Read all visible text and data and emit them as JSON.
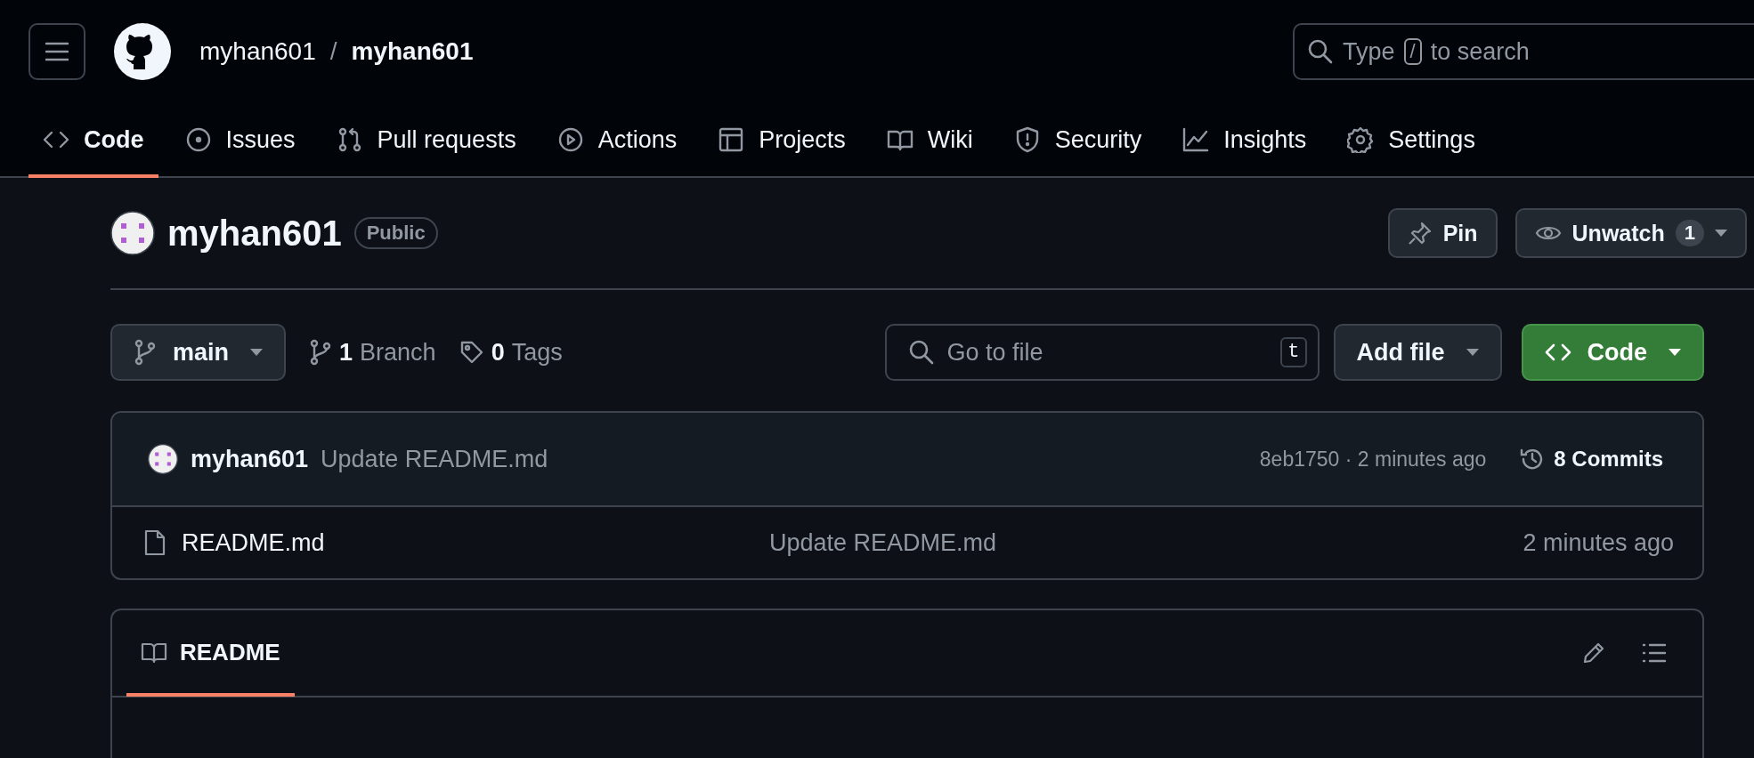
{
  "header": {
    "breadcrumb": [
      {
        "label": "myhan601"
      },
      {
        "label": "myhan601"
      }
    ],
    "separator": "/",
    "search": {
      "prefix": "Type",
      "key": "/",
      "suffix": "to search"
    }
  },
  "tabs": [
    {
      "label": "Code",
      "selected": true
    },
    {
      "label": "Issues",
      "selected": false
    },
    {
      "label": "Pull requests",
      "selected": false
    },
    {
      "label": "Actions",
      "selected": false
    },
    {
      "label": "Projects",
      "selected": false
    },
    {
      "label": "Wiki",
      "selected": false
    },
    {
      "label": "Security",
      "selected": false
    },
    {
      "label": "Insights",
      "selected": false
    },
    {
      "label": "Settings",
      "selected": false
    }
  ],
  "repo": {
    "name": "myhan601",
    "visibility": "Public",
    "pin": "Pin",
    "watch": "Unwatch",
    "watch_count": "1"
  },
  "toolbar": {
    "branch": "main",
    "branch_count": "1",
    "branch_label": "Branch",
    "tag_count": "0",
    "tag_label": "Tags",
    "go_to_file": {
      "placeholder": "Go to file",
      "key": "t"
    },
    "add_file": "Add file",
    "code_button": "Code"
  },
  "commit": {
    "author": "myhan601",
    "message": "Update README.md",
    "meta": "8eb1750 · 2 minutes ago",
    "commits": "8 Commits"
  },
  "files": [
    {
      "name": "README.md",
      "message": "Update README.md",
      "time": "2 minutes ago"
    }
  ],
  "readme": {
    "tabs": [
      {
        "label": "README",
        "selected": true
      }
    ]
  }
}
